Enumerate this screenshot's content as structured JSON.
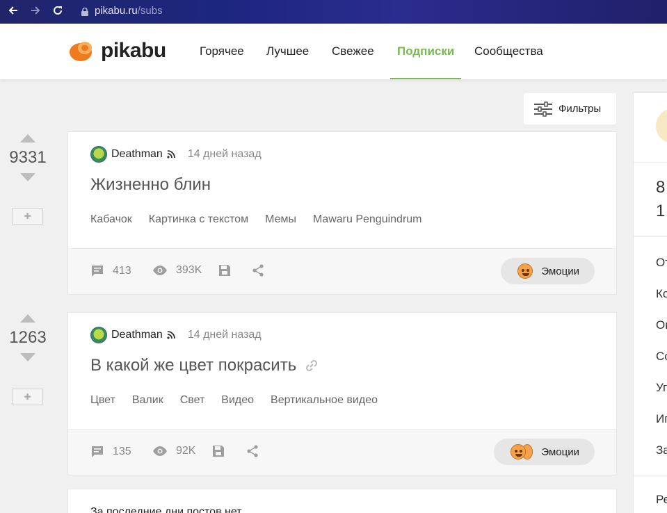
{
  "browser": {
    "url_host": "pikabu.ru",
    "url_path": "/subs"
  },
  "header": {
    "logo_text": "pikabu",
    "nav": [
      {
        "label": "Горячее",
        "active": false
      },
      {
        "label": "Лучшее",
        "active": false
      },
      {
        "label": "Свежее",
        "active": false
      },
      {
        "label": "Подписки",
        "active": true
      },
      {
        "label": "Сообщества",
        "active": false
      }
    ]
  },
  "filters_label": "Фильтры",
  "posts": [
    {
      "rating": "9331",
      "author": "Deathman",
      "time": "14 дней назад",
      "title": "Жизненно блин",
      "tags": [
        "Кабачок",
        "Картинка с текстом",
        "Мемы",
        "Mawaru Penguindrum"
      ],
      "comments": "413",
      "views": "393K",
      "emotions_label": "Эмоции"
    },
    {
      "rating": "1263",
      "author": "Deathman",
      "time": "14 дней назад",
      "title": "В какой же цвет покрасить",
      "tags": [
        "Цвет",
        "Валик",
        "Свет",
        "Видео",
        "Вертикальное видео"
      ],
      "comments": "135",
      "views": "92K",
      "emotions_label": "Эмоции"
    }
  ],
  "no_posts_text": "За последние дни постов нет",
  "sidebar": {
    "stat1": "8",
    "stat2": "1",
    "items": [
      "От",
      "Ко",
      "Оц",
      "Со",
      "Уг",
      "Иг",
      "За"
    ],
    "bottom": "Ре"
  },
  "colors": {
    "accent": "#7ab856",
    "browser_bar": "#1d2680"
  }
}
